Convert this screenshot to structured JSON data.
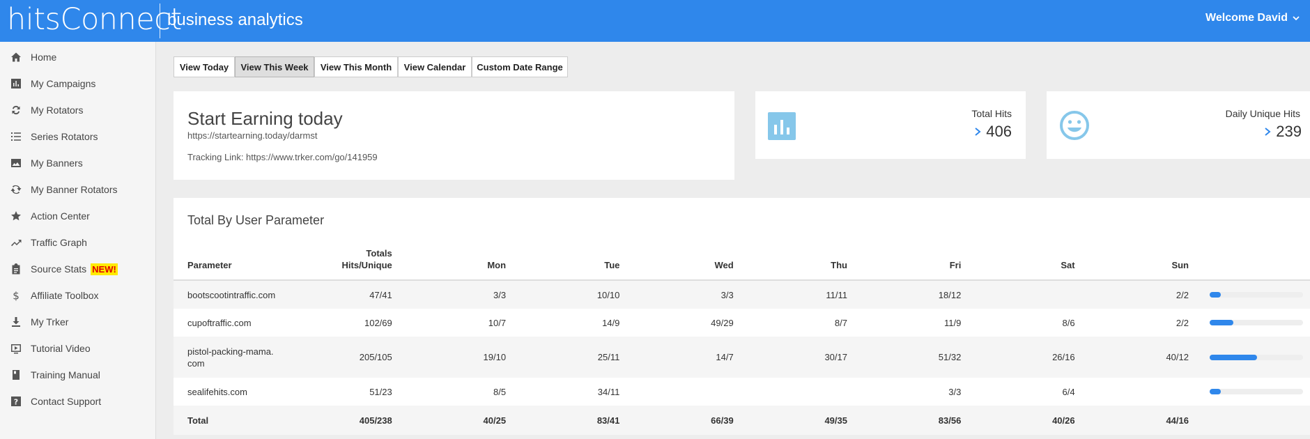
{
  "header": {
    "brand": "hitsConnect",
    "subtitle": "business analytics",
    "welcome": "Welcome David"
  },
  "sidebar": {
    "items": [
      {
        "label": "Home",
        "icon": "home-icon"
      },
      {
        "label": "My Campaigns",
        "icon": "bar-chart-icon"
      },
      {
        "label": "My Rotators",
        "icon": "swap-icon"
      },
      {
        "label": "Series Rotators",
        "icon": "list-icon"
      },
      {
        "label": "My Banners",
        "icon": "image-icon"
      },
      {
        "label": "My Banner Rotators",
        "icon": "refresh-icon"
      },
      {
        "label": "Action Center",
        "icon": "star-icon"
      },
      {
        "label": "Traffic Graph",
        "icon": "trending-up-icon"
      },
      {
        "label": "Source Stats",
        "icon": "clipboard-icon",
        "badge": "NEW!"
      },
      {
        "label": "Affiliate Toolbox",
        "icon": "dollar-icon"
      },
      {
        "label": "My Trker",
        "icon": "download-icon"
      },
      {
        "label": "Tutorial Video",
        "icon": "video-icon"
      },
      {
        "label": "Training Manual",
        "icon": "book-icon"
      },
      {
        "label": "Contact Support",
        "icon": "help-icon"
      }
    ]
  },
  "toolbar": {
    "buttons": [
      {
        "label": "View Today",
        "active": false
      },
      {
        "label": "View This Week",
        "active": true
      },
      {
        "label": "View This Month",
        "active": false
      },
      {
        "label": "View Calendar",
        "active": false
      },
      {
        "label": "Custom Date Range",
        "active": false
      }
    ]
  },
  "campaign": {
    "title": "Start Earning today",
    "url": "https://startearning.today/darmst",
    "tracking": "Tracking Link: https://www.trker.com/go/141959"
  },
  "stats": {
    "total_hits": {
      "label": "Total Hits",
      "value": "406",
      "icon": "bar-chart-icon"
    },
    "daily_unique": {
      "label": "Daily Unique Hits",
      "value": "239",
      "icon": "smiley-icon"
    }
  },
  "colors": {
    "accent": "#2f87eb",
    "icon_blue": "#86c7ea",
    "badge_bg": "#ffea00",
    "badge_text": "#e00000"
  },
  "table": {
    "title": "Total By User Parameter",
    "headers": {
      "parameter": "Parameter",
      "totals_line1": "Totals",
      "totals_line2": "Hits/Unique",
      "mon": "Mon",
      "tue": "Tue",
      "wed": "Wed",
      "thu": "Thu",
      "fri": "Fri",
      "sat": "Sat",
      "sun": "Sun"
    },
    "rows": [
      {
        "parameter": "bootscootintraffic.com",
        "totals": "47/41",
        "mon": "3/3",
        "tue": "10/10",
        "wed": "3/3",
        "thu": "11/11",
        "fri": "18/12",
        "sat": "",
        "sun": "2/2",
        "share": 0.12
      },
      {
        "parameter": "cupoftraffic.com",
        "totals": "102/69",
        "mon": "10/7",
        "tue": "14/9",
        "wed": "49/29",
        "thu": "8/7",
        "fri": "11/9",
        "sat": "8/6",
        "sun": "2/2",
        "share": 0.25
      },
      {
        "parameter": "pistol-packing-mama.com",
        "totals": "205/105",
        "mon": "19/10",
        "tue": "25/11",
        "wed": "14/7",
        "thu": "30/17",
        "fri": "51/32",
        "sat": "26/16",
        "sun": "40/12",
        "share": 0.51
      },
      {
        "parameter": "sealifehits.com",
        "totals": "51/23",
        "mon": "8/5",
        "tue": "34/11",
        "wed": "",
        "thu": "",
        "fri": "3/3",
        "sat": "6/4",
        "sun": "",
        "share": 0.12
      }
    ],
    "total": {
      "label": "Total",
      "totals": "405/238",
      "mon": "40/25",
      "tue": "83/41",
      "wed": "66/39",
      "thu": "49/35",
      "fri": "83/56",
      "sat": "40/26",
      "sun": "44/16"
    }
  }
}
